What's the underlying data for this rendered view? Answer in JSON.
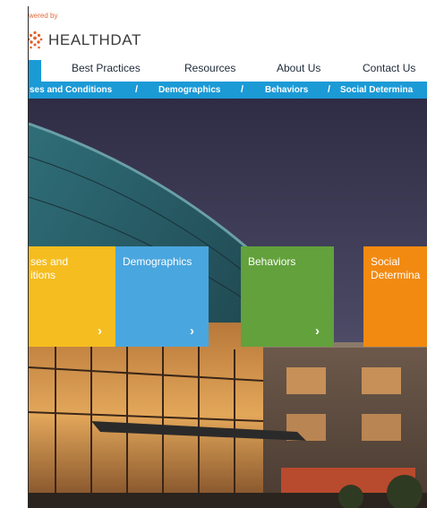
{
  "header": {
    "powered_by": "wered by",
    "logo_text": "HEALTHDAT",
    "brand_color": "#e2622b"
  },
  "main_nav": {
    "active_color": "#1b9ad6",
    "items": [
      {
        "label": "Best Practices"
      },
      {
        "label": "Resources"
      },
      {
        "label": "About Us"
      },
      {
        "label": "Contact Us"
      }
    ]
  },
  "sub_nav": {
    "items": [
      {
        "label": "ses and Conditions"
      },
      {
        "label": "Demographics"
      },
      {
        "label": "Behaviors"
      },
      {
        "label": "Social Determina"
      }
    ],
    "separator": "/"
  },
  "tiles": [
    {
      "label": "ses and\nitions",
      "color": "#f5bd1f",
      "icon": "chevron-right-icon",
      "arrow": "›"
    },
    {
      "label": "Demographics",
      "color": "#4aa6de",
      "icon": "chevron-right-icon",
      "arrow": "›"
    },
    {
      "label": "Behaviors",
      "color": "#62a13c",
      "icon": "chevron-right-icon",
      "arrow": "›"
    },
    {
      "label": "Social\nDetermina",
      "color": "#f28a12",
      "icon": "chevron-right-icon",
      "arrow": "›"
    }
  ]
}
